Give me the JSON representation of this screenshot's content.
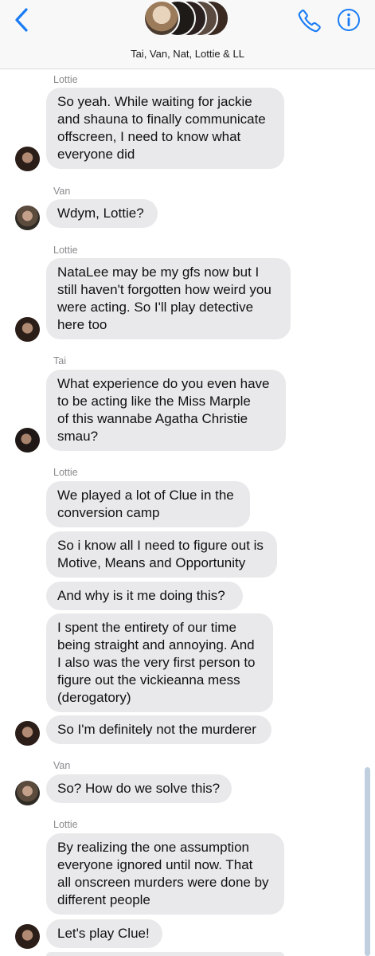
{
  "header": {
    "title": "Tai, Van, Nat, Lottie & LL",
    "back_icon": "chevron-left-icon",
    "call_icon": "phone-icon",
    "info_icon": "info-icon",
    "accent_color": "#1a7cf5"
  },
  "messages": [
    {
      "sender": "Lottie",
      "lines": [
        "So yeah. While waiting for jackie",
        "and shauna to finally communicate",
        "offscreen, I need to know what",
        "everyone did"
      ]
    },
    {
      "sender": "Van",
      "lines": [
        "Wdym, Lottie?"
      ]
    },
    {
      "sender": "Lottie",
      "lines": [
        "NataLee may be my gfs now but I",
        "still haven't forgotten how weird you",
        "were acting. So I'll play detective",
        "here too"
      ]
    },
    {
      "sender": "Tai",
      "lines": [
        "What experience do you even have",
        "to be acting like the Miss Marple",
        "of this wannabe Agatha Christie",
        "smau?"
      ]
    },
    {
      "sender": "Lottie",
      "lines": [
        "We played a lot of Clue in the",
        "conversion camp"
      ]
    },
    {
      "lines": [
        "So i know all I need to figure out is",
        "Motive, Means and Opportunity"
      ]
    },
    {
      "lines": [
        "And why is it  me doing this?"
      ]
    },
    {
      "lines": [
        "I spent the entirety of our time",
        "being straight and annoying. And",
        "I also was the very first person to",
        "figure out the vickieanna mess",
        "(derogatory)"
      ]
    },
    {
      "lines": [
        "So I'm definitely not the murderer"
      ]
    },
    {
      "sender": "Van",
      "lines": [
        "So? How do we solve this?"
      ]
    },
    {
      "sender": "Lottie",
      "lines": [
        "By realizing the one assumption",
        "everyone ignored until now. That",
        "all onscreen murders were done by",
        "different people"
      ]
    },
    {
      "lines": [
        "Let's play Clue!"
      ]
    }
  ]
}
